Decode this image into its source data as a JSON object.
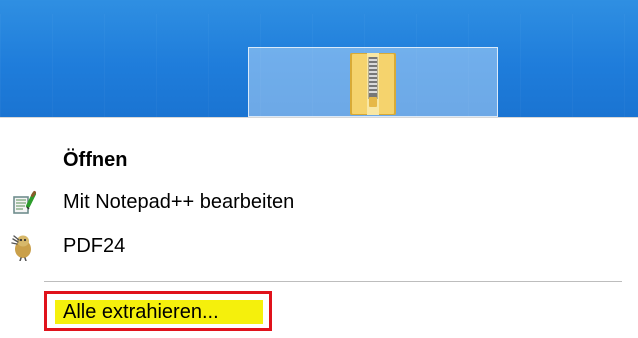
{
  "desktop": {
    "selected_item_icon": "zip-folder-icon"
  },
  "context_menu": {
    "items": [
      {
        "label": "Öffnen",
        "icon": ""
      },
      {
        "label": "Mit Notepad++ bearbeiten",
        "icon": "notepad-plus-plus-icon"
      },
      {
        "label": "PDF24",
        "icon": "pdf24-icon"
      },
      {
        "label": "Alle extrahieren...",
        "icon": ""
      }
    ]
  },
  "colors": {
    "highlight_fill": "#f5f00c",
    "highlight_border": "#e0121b",
    "desktop_blue": "#1f7ddb"
  }
}
